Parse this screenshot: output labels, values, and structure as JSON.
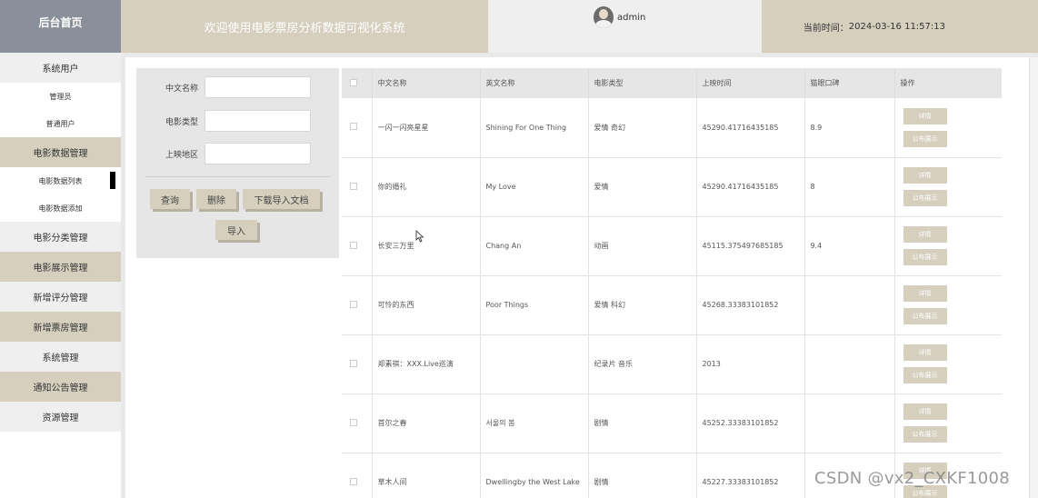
{
  "header": {
    "brand": "后台首页",
    "title": "欢迎使用电影票房分析数据可视化系统",
    "username": "admin",
    "time_label": "当前时间：",
    "time_value": "2024-03-16 11:57:13"
  },
  "sidebar": {
    "system_users": "系统用户",
    "admin": "管理员",
    "normal_user": "普通用户",
    "movie_data_mgmt": "电影数据管理",
    "movie_data_list": "电影数据列表",
    "movie_data_add": "电影数据添加",
    "category_mgmt": "电影分类管理",
    "display_mgmt": "电影展示管理",
    "rating_mgmt": "新增评分管理",
    "boxoffice_mgmt": "新增票房管理",
    "system_mgmt": "系统管理",
    "notice_mgmt": "通知公告管理",
    "resource_mgmt": "资源管理"
  },
  "search": {
    "cn_name_label": "中文名称",
    "type_label": "电影类型",
    "region_label": "上映地区",
    "query_btn": "查询",
    "delete_btn": "删除",
    "download_btn": "下载导入文档",
    "import_btn": "导入"
  },
  "table": {
    "headers": {
      "cn_name": "中文名称",
      "en_name": "英文名称",
      "type": "电影类型",
      "release": "上映时间",
      "maoyan": "猫眼口碑",
      "ops": "操作"
    },
    "detail_btn": "详情",
    "publish_btn": "公布展示",
    "rows": [
      {
        "cn": "一闪一闪亮星星",
        "en": "Shining For One Thing",
        "type": "爱情 奇幻",
        "release": "45290.41716435185",
        "score": "8.9"
      },
      {
        "cn": "你的婚礼",
        "en": "My Love",
        "type": "爱情",
        "release": "45290.41716435185",
        "score": "8"
      },
      {
        "cn": "长安三万里",
        "en": "Chang An",
        "type": "动画",
        "release": "45115.375497685185",
        "score": "9.4"
      },
      {
        "cn": "可怜的东西",
        "en": "Poor Things",
        "type": "爱情 科幻",
        "release": "45268.33383101852",
        "score": ""
      },
      {
        "cn": "郑素祺：XXX.Live巡演",
        "en": "",
        "type": "纪录片 音乐",
        "release": "2013",
        "score": ""
      },
      {
        "cn": "首尔之春",
        "en": "서울의 봄",
        "type": "剧情",
        "release": "45252.33383101852",
        "score": ""
      },
      {
        "cn": "草木人间",
        "en": "Dwellingby the West Lake",
        "type": "剧情",
        "release": "45227.33383101852",
        "score": ""
      }
    ]
  },
  "watermark": "CSDN @vx2_CXKF1008"
}
